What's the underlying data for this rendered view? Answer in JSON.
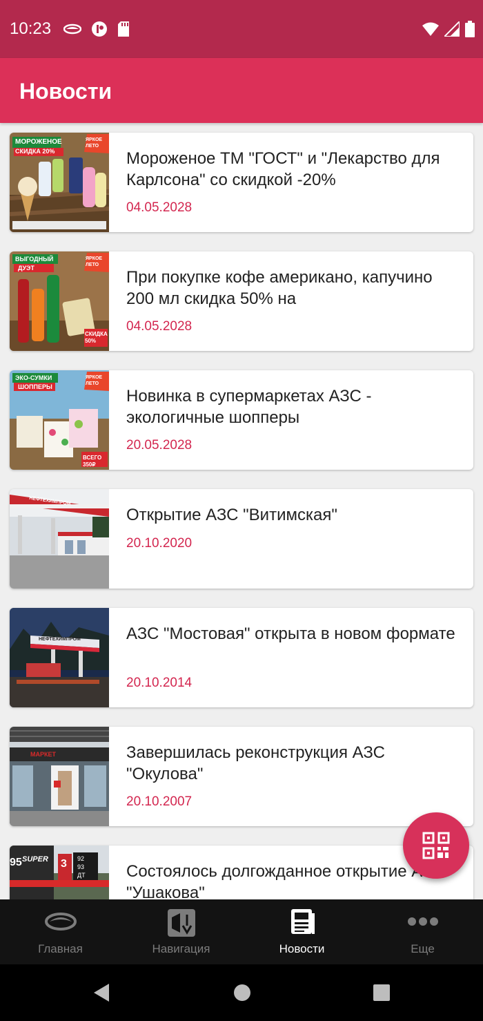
{
  "status_bar": {
    "time": "10:23"
  },
  "app_bar": {
    "title": "Новости"
  },
  "news": [
    {
      "title": "Мороженое ТМ \"ГОСТ\" и \"Лекарство для Карлсона\" со скидкой -20%",
      "date": "04.05.2028",
      "thumb": {
        "banner": "МОРОЖЕНОЕ",
        "sub": "СКИДКА 20%",
        "badge": "ЯРКОЕ ЛЕТО"
      }
    },
    {
      "title": "При покупке кофе американо, капучино 200 мл скидка 50% на",
      "date": "04.05.2028",
      "thumb": {
        "banner": "ВЫГОДНЫЙ",
        "sub": "ДУЭТ",
        "badge": "ЯРКОЕ ЛЕТО",
        "price": "СКИДКА 50%"
      }
    },
    {
      "title": "Новинка в супермаркетах АЗС - экологичные шопперы",
      "date": "20.05.2028",
      "thumb": {
        "banner": "ЭКО-СУМКИ",
        "sub": "ШОППЕРЫ",
        "badge": "ЯРКОЕ ЛЕТО",
        "price": "ВСЕГО 350₽"
      }
    },
    {
      "title": "Открытие АЗС \"Витимская\"",
      "date": "20.10.2020",
      "thumb": {
        "sign": "НЕФТЕХИМПРОМ"
      }
    },
    {
      "title": "АЗС \"Мостовая\" открыта в новом формате",
      "date": "20.10.2014",
      "thumb": {
        "sign": "НЕФТЕХИМПРОМ"
      }
    },
    {
      "title": "Завершилась реконструкция АЗС \"Окулова\"",
      "date": "20.10.2007",
      "thumb": {
        "sign": "МАРКЕТ"
      }
    },
    {
      "title": "Состоялось долгожданное открытие АЗС \"Ушакова\"",
      "date": "",
      "thumb": {
        "sign": "SUPER",
        "num": "95",
        "n3": "3",
        "p1": "92",
        "p2": "93",
        "p3": "ДТ"
      }
    }
  ],
  "fab": {
    "icon": "qr-code-icon"
  },
  "bottom_nav": [
    {
      "label": "Главная",
      "icon": "home-logo-icon",
      "active": false
    },
    {
      "label": "Навигация",
      "icon": "map-navigation-icon",
      "active": false
    },
    {
      "label": "Новости",
      "icon": "newspaper-icon",
      "active": true
    },
    {
      "label": "Еще",
      "icon": "more-dots-icon",
      "active": false
    }
  ],
  "colors": {
    "status_bar": "#b3294d",
    "app_bar": "#dc3058",
    "accent": "#d3264f",
    "nav_bg": "#131313"
  }
}
